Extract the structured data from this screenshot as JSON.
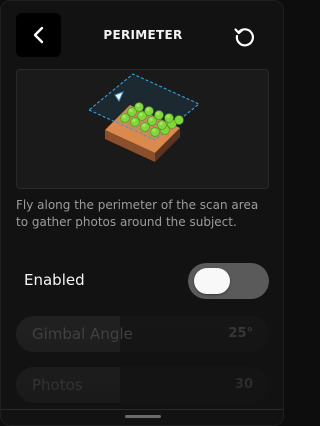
{
  "header": {
    "title": "PERIMETER",
    "back_icon": "chevron-left-icon",
    "reset_icon": "reset-icon"
  },
  "preview": {
    "icon": "perimeter-scan-illustration"
  },
  "description": "Fly along the perimeter of the scan area to gather photos around the subject.",
  "enabled": {
    "label": "Enabled",
    "state": false
  },
  "sliders": [
    {
      "label": "Gimbal Angle",
      "value": "25°",
      "fill_fraction": 0.41
    },
    {
      "label": "Photos",
      "value": "30",
      "fill_fraction": 0.41
    }
  ],
  "colors": {
    "background": "#121212",
    "accent": "#3aa0d8",
    "tree_green": "#7ed83a",
    "ground_brown": "#8a4f2c"
  }
}
